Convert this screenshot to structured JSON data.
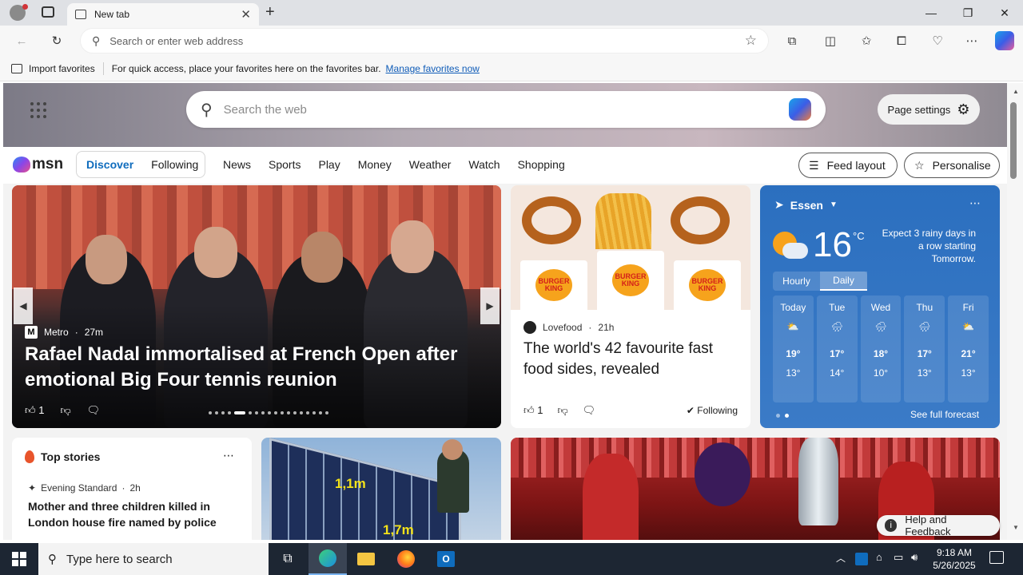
{
  "browser": {
    "tab_title": "New tab",
    "address_placeholder": "Search or enter web address"
  },
  "favorites_bar": {
    "import_label": "Import favorites",
    "message": "For quick access, place your favorites here on the favorites bar.",
    "manage_link": "Manage favorites now"
  },
  "msn": {
    "search_placeholder": "Search the web",
    "page_settings_label": "Page settings",
    "logo_text": "msn",
    "segment": {
      "discover": "Discover",
      "following": "Following"
    },
    "nav_links": [
      "News",
      "Sports",
      "Play",
      "Money",
      "Weather",
      "Watch",
      "Shopping"
    ],
    "feed_layout_label": "Feed layout",
    "personalise_label": "Personalise"
  },
  "hero_card": {
    "source": "Metro",
    "age": "27m",
    "headline": "Rafael Nadal immortalised at French Open after emotional Big Four tennis reunion",
    "likes": "1"
  },
  "food_card": {
    "source": "Lovefood",
    "age": "21h",
    "headline": "The world's 42 favourite fast food sides, revealed",
    "likes": "1",
    "following_label": "Following",
    "brand_text": "BURGER KING"
  },
  "weather": {
    "location": "Essen",
    "temperature": "16",
    "unit": "°C",
    "message": "Expect 3 rainy days in a row starting Tomorrow.",
    "tabs": [
      "Hourly",
      "Daily"
    ],
    "days": [
      {
        "name": "Today",
        "high": "19°",
        "low": "13°",
        "icon": "partly-sunny-icon"
      },
      {
        "name": "Tue",
        "high": "17°",
        "low": "14°",
        "icon": "rain-cloud-icon"
      },
      {
        "name": "Wed",
        "high": "18°",
        "low": "10°",
        "icon": "rain-cloud-icon"
      },
      {
        "name": "Thu",
        "high": "17°",
        "low": "13°",
        "icon": "rain-cloud-icon"
      },
      {
        "name": "Fri",
        "high": "21°",
        "low": "13°",
        "icon": "partly-sunny-icon"
      }
    ],
    "see_full_forecast": "See full forecast"
  },
  "top_stories": {
    "title": "Top stories",
    "source": "Evening Standard",
    "age": "2h",
    "headline": "Mother and three children killed in London house fire named by police"
  },
  "solar_card": {
    "label1": "1,1m",
    "label2": "1,7m"
  },
  "help_label": "Help and Feedback",
  "taskbar": {
    "search_placeholder": "Type here to search",
    "time": "9:18 AM",
    "date": "5/26/2025"
  },
  "colors": {
    "accent": "#0f6cbd",
    "weather_bg": "#2b6fbf",
    "taskbar": "#1d2633"
  }
}
